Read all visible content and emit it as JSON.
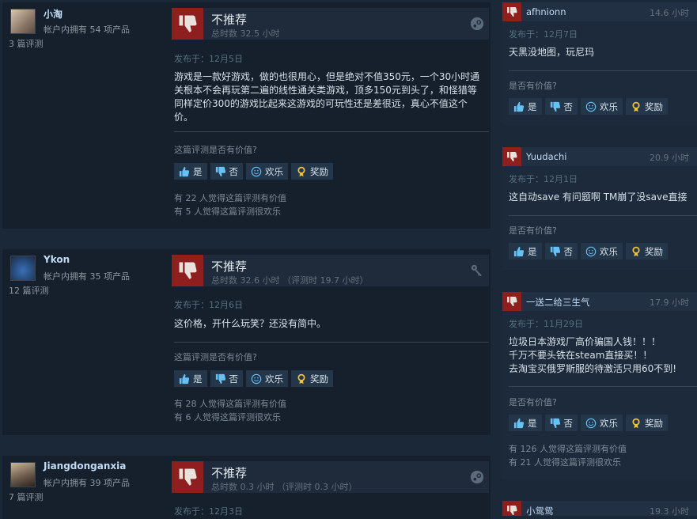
{
  "colors": {
    "background": "#1b2838",
    "not_recommended": "#8f1f1f",
    "link_blue": "#67c1f5",
    "award_gold": "#f2c23b"
  },
  "buttons": {
    "yes": "是",
    "no": "否",
    "funny": "欢乐",
    "award": "奖励"
  },
  "question": "这篇评测是否有价值?",
  "question_short": "是否有价值?",
  "reviews": [
    {
      "author": "小淘",
      "products": "帐户内拥有 54 项产品",
      "review_count": "3 篇评测",
      "verdict": "不推荐",
      "hours": "总时数 32.5 小时",
      "platform_icon": "steam-icon",
      "posted": "发布于：12月5日",
      "content": "游戏是一款好游戏，做的也很用心，但是绝对不值350元，一个30小时通关根本不会再玩第二遍的线性通关类游戏，顶多150元到头了，和怪猎等同样定价300的游戏比起来这游戏的可玩性还是差很远，真心不值这个价。",
      "helpful": "有 22 人觉得这篇评测有价值",
      "funny": "有 5 人觉得这篇评测很欢乐"
    },
    {
      "author": "Ykon",
      "products": "帐户内拥有 35 项产品",
      "review_count": "12 篇评测",
      "verdict": "不推荐",
      "hours": "总时数 32.6 小时 （评测时 19.7 小时）",
      "platform_icon": "key-icon",
      "posted": "发布于：12月6日",
      "content": "这价格，开什么玩笑？还没有简中。",
      "helpful": "有 28 人觉得这篇评测有价值",
      "funny": "有 6 人觉得这篇评测很欢乐"
    },
    {
      "author": "Jiangdonganxia",
      "products": "帐户内拥有 39 项产品",
      "review_count": "7 篇评测",
      "verdict": "不推荐",
      "hours": "总时数 0.3 小时 （评测时 0.3 小时）",
      "platform_icon": "steam-icon",
      "posted": "发布于：12月3日"
    }
  ],
  "side_reviews": [
    {
      "author": "afhnionn",
      "hours": "14.6 小时",
      "posted": "发布于：12月7日",
      "lines": [
        "天黑没地图，玩尼玛"
      ]
    },
    {
      "author": "Yuudachi",
      "hours": "20.9 小时",
      "posted": "发布于：12月1日",
      "lines": [
        "这自动save 有问题啊 TM崩了没save直接"
      ]
    },
    {
      "author": "一送二给三生气",
      "hours": "17.9 小时",
      "posted": "发布于：11月29日",
      "lines": [
        "垃圾日本游戏厂高价骗国人钱！！！",
        "千万不要头铁在steam直接买！！",
        "去淘宝买俄罗斯服的待激活只用60不到!"
      ],
      "helpful": "有 126 人觉得这篇评测有价值",
      "funny": "有 21 人觉得这篇评测很欢乐"
    },
    {
      "author": "小鸳鸳",
      "hours": "19.3 小时"
    }
  ]
}
